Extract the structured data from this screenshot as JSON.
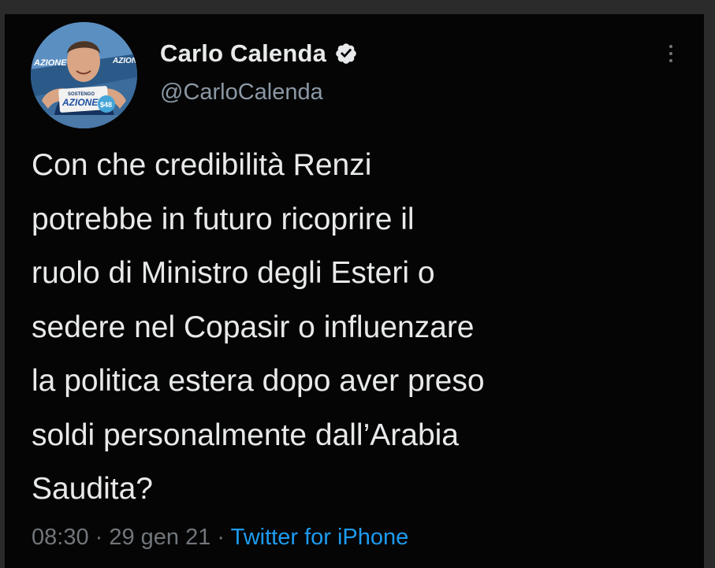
{
  "tweet": {
    "author": {
      "display_name": "Carlo Calenda",
      "handle": "@CarloCalenda",
      "verified": true,
      "avatar_icon": "profile-photo",
      "avatar_texts": {
        "party_left": "AZIONE",
        "party_right": "AZIONE",
        "shirt_top": "SOSTENGO",
        "shirt_logo": "AZIONE",
        "badge": "$48"
      }
    },
    "text": "Con che credibilità Renzi\npotrebbe in futuro ricoprire il\nruolo di Ministro degli Esteri o\nsedere nel Copasir o influenzare\nla politica estera dopo aver preso\nsoldi personalmente dall’Arabia\nSaudita?",
    "time": "08:30",
    "separator": " · ",
    "date": "29 gen 21",
    "source": "Twitter for iPhone"
  },
  "icons": {
    "verified": "verified-badge-icon",
    "more": "more-options-icon"
  },
  "colors": {
    "background": "#050505",
    "text_primary": "#e7e9ea",
    "text_secondary": "#71767b",
    "link": "#1d9bf0"
  }
}
